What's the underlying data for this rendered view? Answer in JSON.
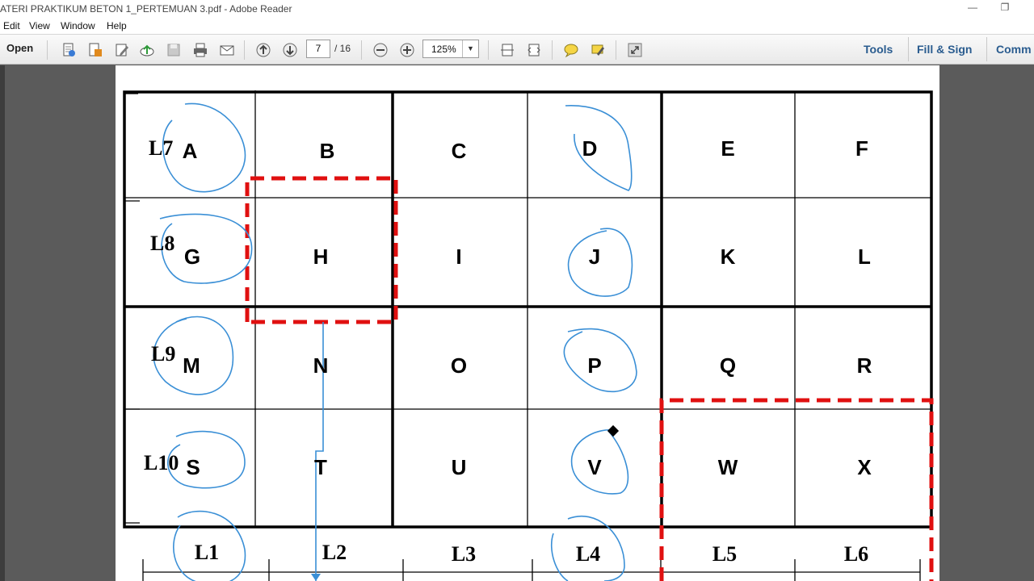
{
  "window": {
    "title": "ATERI PRAKTIKUM BETON 1_PERTEMUAN 3.pdf - Adobe Reader",
    "minimize_glyph": "—",
    "restore_glyph": "❐"
  },
  "menu": [
    "Edit",
    "View",
    "Window",
    "Help"
  ],
  "toolbar": {
    "open_label": "Open",
    "page_current": "7",
    "page_total": "/ 16",
    "zoom": "125%",
    "zoom_dropdown_glyph": "▼",
    "icons": [
      "create-pdf-icon",
      "convert-icon",
      "edit-icon",
      "upload-icon",
      "save-icon",
      "print-icon",
      "email-icon",
      "prev-page-icon",
      "next-page-icon",
      "zoom-out-icon",
      "zoom-in-icon",
      "fit-page-icon",
      "fit-width-icon",
      "comment-icon",
      "highlight-icon",
      "fullscreen-icon"
    ]
  },
  "right_panels": {
    "tools": "Tools",
    "fill_sign": "Fill & Sign",
    "comment": "Comm"
  },
  "document": {
    "grid_labels": [
      [
        "A",
        "B",
        "C",
        "D",
        "E",
        "F"
      ],
      [
        "G",
        "H",
        "I",
        "J",
        "K",
        "L"
      ],
      [
        "M",
        "N",
        "O",
        "P",
        "Q",
        "R"
      ],
      [
        "S",
        "T",
        "U",
        "V",
        "W",
        "X"
      ]
    ],
    "row_labels": [
      "L7",
      "L8",
      "L9",
      "L10"
    ],
    "column_labels": [
      "L1",
      "L2",
      "L3",
      "L4",
      "L5",
      "L6"
    ],
    "colors": {
      "annotation_blue": "#3a8fd6",
      "highlight_red": "#e01010",
      "grid": "#000000"
    }
  }
}
